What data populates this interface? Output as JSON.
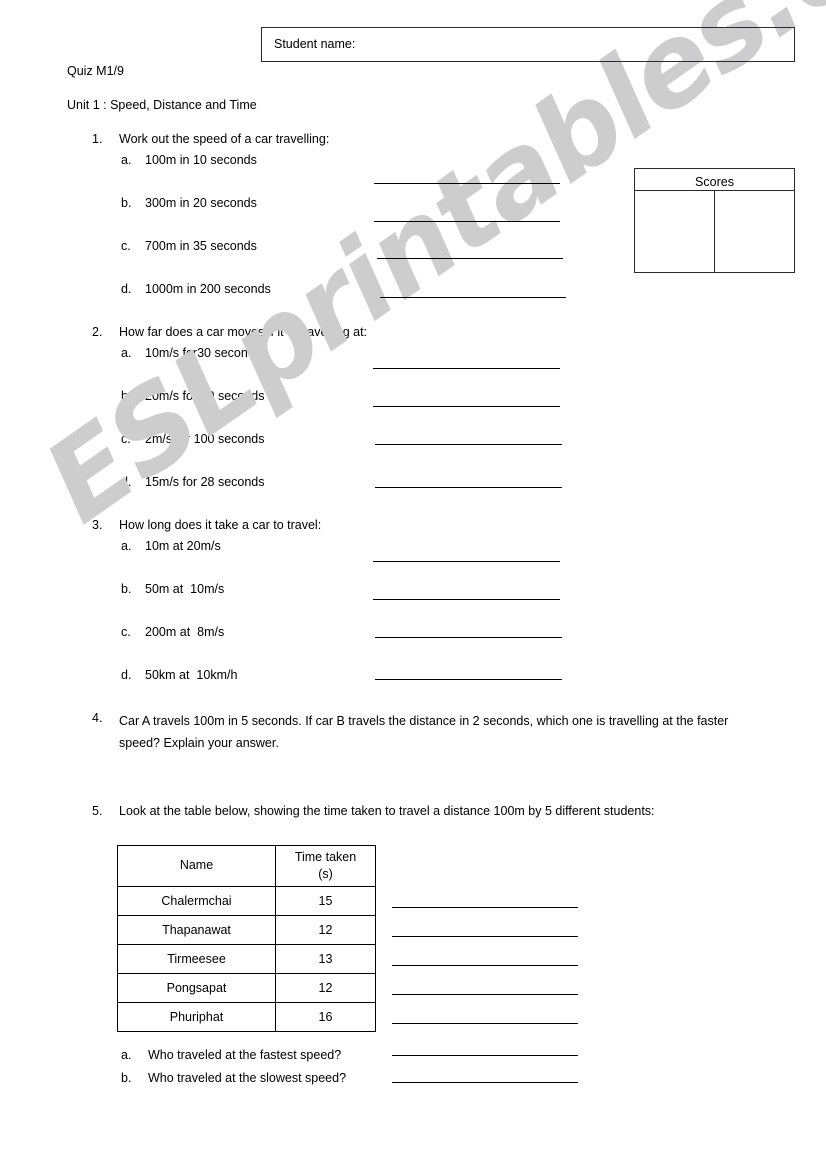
{
  "header": {
    "student_name_label": "Student name:",
    "quiz_code": "Quiz M1/9",
    "unit_title": "Unit 1 : Speed, Distance and Time"
  },
  "scores": {
    "title": "Scores",
    "left_value": "",
    "right_value": ""
  },
  "questions": [
    {
      "number": "1.",
      "prompt": "Work out the speed of a car travelling:",
      "items": [
        {
          "letter": "a.",
          "text": "100m in 10 seconds"
        },
        {
          "letter": "b.",
          "text": "300m in 20 seconds"
        },
        {
          "letter": "c.",
          "text": "700m in 35 seconds"
        },
        {
          "letter": "d.",
          "text": "1000m in 200 seconds"
        }
      ]
    },
    {
      "number": "2.",
      "prompt": "How far does a car moves if it is travelling at:",
      "items": [
        {
          "letter": "a.",
          "text": "10m/s for30 seconds"
        },
        {
          "letter": "b.",
          "text": "20m/s for 20 seconds"
        },
        {
          "letter": "c.",
          "text": "2m/s for 100 seconds"
        },
        {
          "letter": "d.",
          "text": "15m/s for 28 seconds"
        }
      ]
    },
    {
      "number": "3.",
      "prompt": "How long does it take a car to travel:",
      "items": [
        {
          "letter": "a.",
          "text": "10m at 20m/s"
        },
        {
          "letter": "b.",
          "text": "50m at  10m/s"
        },
        {
          "letter": "c.",
          "text": "200m at  8m/s"
        },
        {
          "letter": "d.",
          "text": "50km at  10km/h"
        }
      ]
    },
    {
      "number": "4.",
      "prompt": "Car A travels 100m  in 5 seconds. If  car B travels the distance in 2 seconds, which one is travelling at the faster speed? Explain your answer.",
      "items": []
    },
    {
      "number": "5.",
      "prompt": "Look at the table below, showing the time taken to travel a distance 100m by 5 different students:",
      "items": [
        {
          "letter": "a.",
          "text": "Who traveled at the fastest speed?"
        },
        {
          "letter": "b.",
          "text": "Who traveled at the slowest speed?"
        }
      ]
    }
  ],
  "students_table": {
    "columns": [
      "Name",
      "Time taken (s)"
    ],
    "column_header_lines": [
      [
        "Name"
      ],
      [
        "Time taken",
        "(s)"
      ]
    ],
    "rows": [
      {
        "name": "Chalermchai",
        "time": "15"
      },
      {
        "name": "Thapanawat",
        "time": "12"
      },
      {
        "name": "Tirmeesee",
        "time": "13"
      },
      {
        "name": "Pongsapat",
        "time": "12"
      },
      {
        "name": "Phuriphat",
        "time": "16"
      }
    ]
  },
  "watermark": {
    "text": "ESLprintables.com",
    "color": "#cdcdcd"
  }
}
